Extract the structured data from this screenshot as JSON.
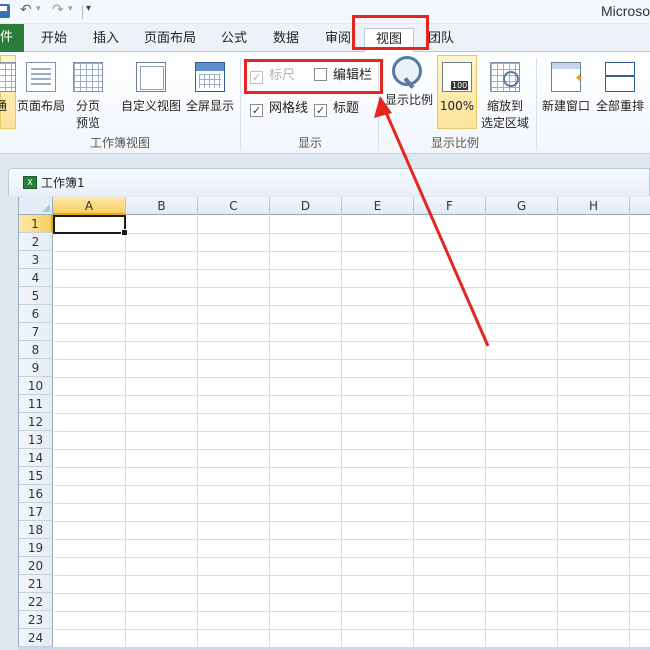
{
  "window": {
    "title": "Microso"
  },
  "quick_access": {
    "undo_icon": "undo-icon",
    "redo_icon": "redo-icon"
  },
  "tabs": [
    {
      "label": "件",
      "active": false
    },
    {
      "label": "开始",
      "active": false
    },
    {
      "label": "插入",
      "active": false
    },
    {
      "label": "页面布局",
      "active": false
    },
    {
      "label": "公式",
      "active": false
    },
    {
      "label": "数据",
      "active": false
    },
    {
      "label": "审阅",
      "active": false
    },
    {
      "label": "视图",
      "active": true
    },
    {
      "label": "团队",
      "active": false
    }
  ],
  "ribbon": {
    "workbook_views": {
      "group_label": "工作簿视图",
      "normal_label": "通",
      "page_layout_label": "页面布局",
      "page_break_label_1": "分页",
      "page_break_label_2": "预览",
      "custom_views_label": "自定义视图",
      "full_screen_label": "全屏显示"
    },
    "show": {
      "group_label": "显示",
      "ruler": {
        "label": "标尺",
        "checked": true,
        "enabled": false
      },
      "formula_bar": {
        "label": "编辑栏",
        "checked": false,
        "enabled": true
      },
      "gridlines": {
        "label": "网格线",
        "checked": true,
        "enabled": true
      },
      "headings": {
        "label": "标题",
        "checked": true,
        "enabled": true
      }
    },
    "zoom": {
      "group_label": "显示比例",
      "zoom_label": "显示比例",
      "hundred_label": "100%",
      "zoom_sel_label_1": "缩放到",
      "zoom_sel_label_2": "选定区域"
    },
    "window": {
      "new_window_label": "新建窗口",
      "arrange_all_label": "全部重排"
    }
  },
  "workbook": {
    "name": "工作簿1",
    "columns": [
      "A",
      "B",
      "C",
      "D",
      "E",
      "F",
      "G",
      "H"
    ],
    "rows": [
      "1",
      "2",
      "3",
      "4",
      "5",
      "6",
      "7",
      "8",
      "9",
      "10",
      "11",
      "12",
      "13",
      "14",
      "15",
      "16",
      "17",
      "18",
      "19",
      "20",
      "21",
      "22",
      "23",
      "24"
    ],
    "active_cell": "A1"
  },
  "annotation": {
    "color": "#e3261f"
  }
}
